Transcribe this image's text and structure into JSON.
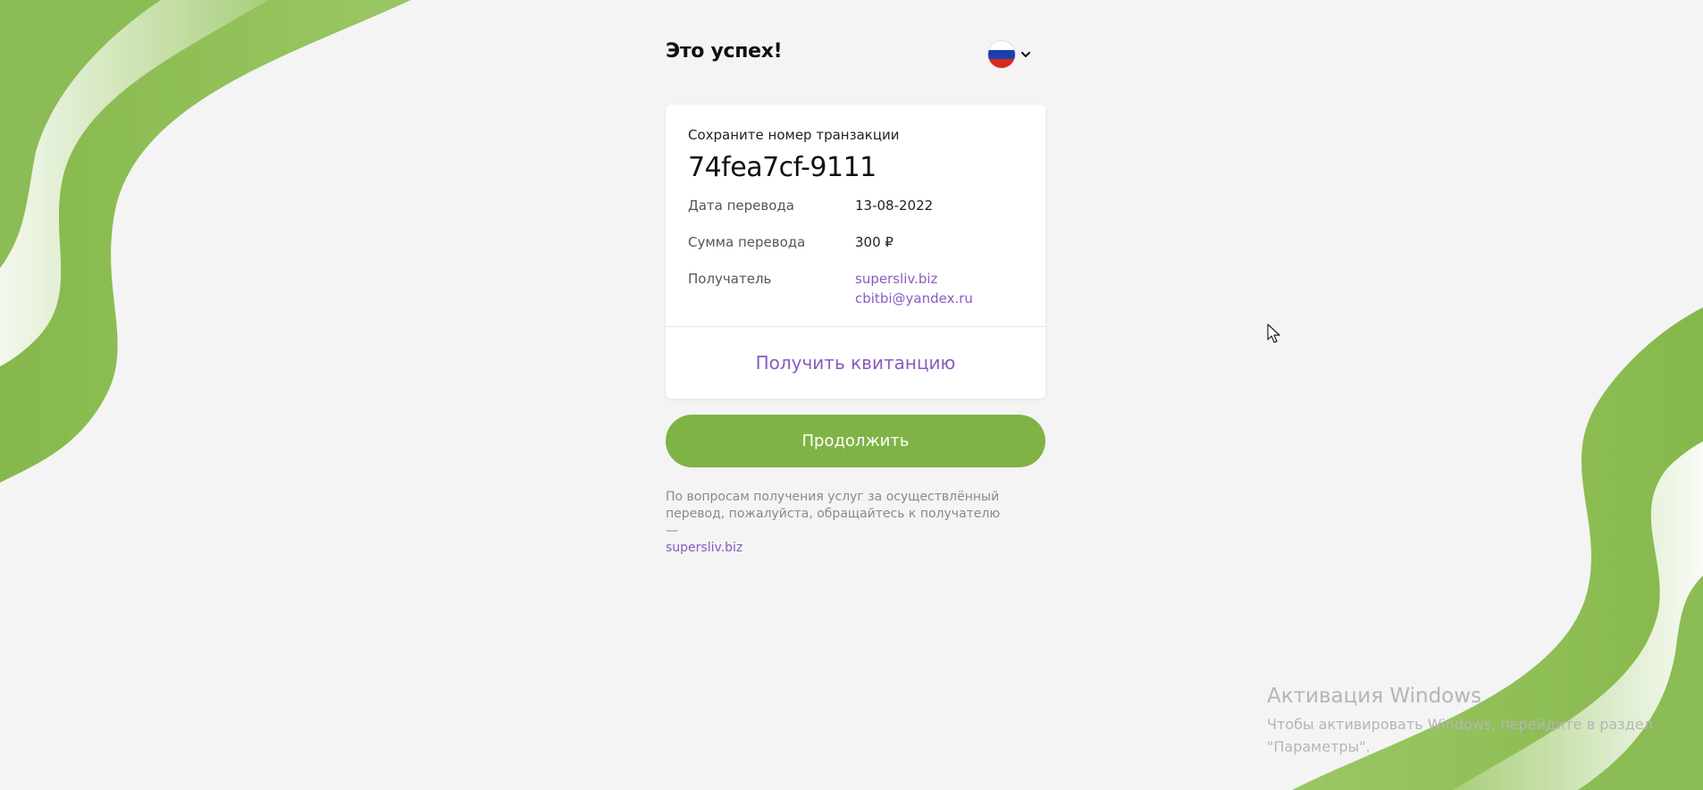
{
  "header": {
    "title": "Это успех!",
    "language_flag": "russia-flag-icon"
  },
  "card": {
    "save_label": "Сохраните номер транзакции",
    "transaction_id": "74fea7cf-9111",
    "rows": [
      {
        "label": "Дата перевода",
        "value": "13-08-2022"
      },
      {
        "label": "Сумма перевода",
        "value": "300 ₽"
      }
    ],
    "recipient": {
      "label": "Получатель",
      "site": "supersliv.biz",
      "email": "cbitbi@yandex.ru"
    },
    "receipt_label": "Получить квитанцию"
  },
  "continue_label": "Продолжить",
  "note": {
    "text": "По вопросам получения услуг за осуществлённый перевод, пожалуйста, обращайтесь к получателю —",
    "link": "supersliv.biz"
  },
  "windows_activation": {
    "title": "Активация Windows",
    "line1": "Чтобы активировать Windows, перейдите в раздел",
    "line2": "\"Параметры\"."
  },
  "colors": {
    "accent_green": "#80b345",
    "link_purple": "#8a5ac2",
    "background": "#f4f4f4"
  }
}
